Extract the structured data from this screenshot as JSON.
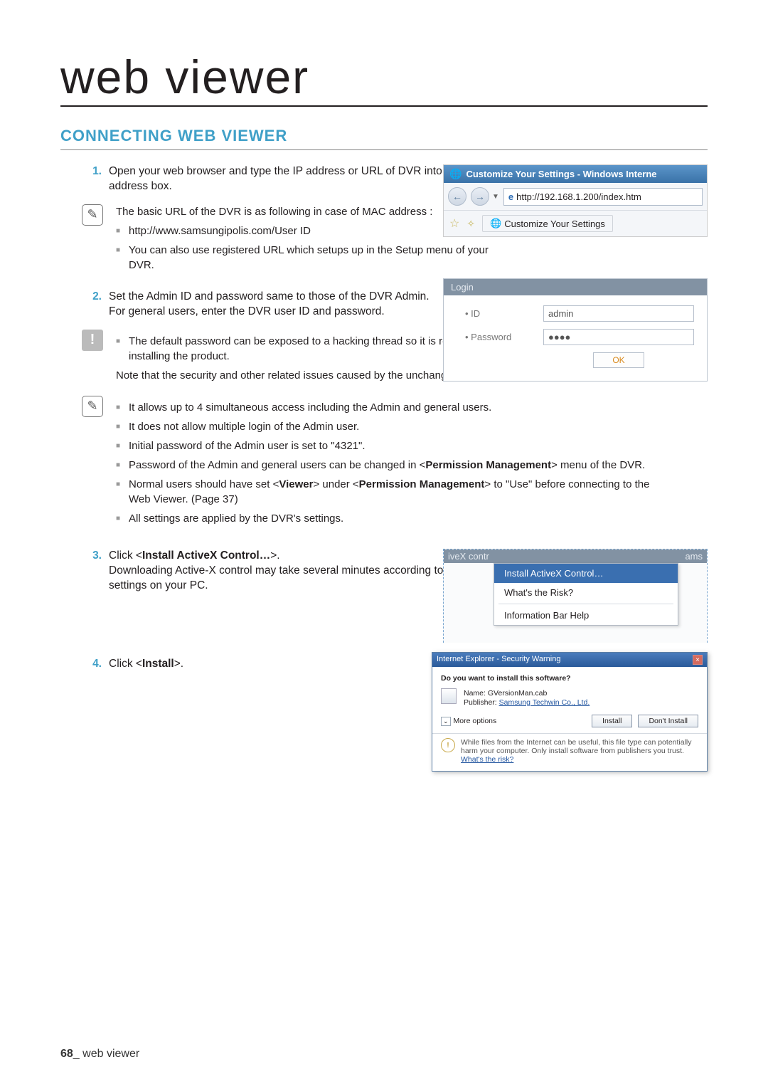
{
  "page_title": "web viewer",
  "section_title": "CONNECTING WEB VIEWER",
  "steps": {
    "s1": {
      "num": "1.",
      "text": "Open your web browser and type the IP address or URL of DVR into the URL address box."
    },
    "note1": {
      "text": "The basic URL of the DVR is as following in case of MAC address :",
      "b1": "http://www.samsungipolis.com/User ID",
      "b2": "You can also use registered URL which setups up in the Setup menu of your DVR."
    },
    "s2": {
      "num": "2.",
      "l1": "Set the Admin ID and password same to those of the DVR Admin.",
      "l2": "For general users, enter the DVR user ID and password."
    },
    "warn1": {
      "b1": "The default password can be exposed to a hacking thread so it is recommended to change the password after installing the product.",
      "b2": "Note that the security and other related issues caused by the unchanged password shall be responsible for the user."
    },
    "note2": {
      "b1": "It allows up to 4 simultaneous access including the Admin and general users.",
      "b2": "It does not allow multiple login of the Admin user.",
      "b3": "Initial password of the Admin user is set to \"4321\".",
      "b4_pre": "Password of the Admin and general users can be changed in <",
      "b4_bold": "Permission Management",
      "b4_post": "> menu of the DVR.",
      "b5_pre": "Normal users should have set <",
      "b5_bold1": "Viewer",
      "b5_mid": "> under <",
      "b5_bold2": "Permission Management",
      "b5_post": "> to \"Use\" before connecting to the Web Viewer. (Page 37)",
      "b6": "All settings are applied by the DVR's settings."
    },
    "s3": {
      "num": "3.",
      "pre": "Click <",
      "bold": "Install ActiveX Control…",
      "post": ">.",
      "l2": "Downloading Active-X control may take several minutes according to the security settings on your PC."
    },
    "s4": {
      "num": "4.",
      "pre": "Click <",
      "bold": "Install",
      "post": ">."
    }
  },
  "ie_window": {
    "title": "Customize Your Settings - Windows Interne",
    "url": "http://192.168.1.200/index.htm",
    "tab": "Customize Your Settings"
  },
  "login": {
    "title": "Login",
    "id_label": "ID",
    "id_value": "admin",
    "pw_label": "Password",
    "pw_value": "●●●●",
    "ok": "OK"
  },
  "ax": {
    "bar_left": "iveX contr",
    "bar_right": "ams",
    "item1": "Install ActiveX Control…",
    "item2": "What's the Risk?",
    "item3": "Information Bar Help"
  },
  "sec": {
    "title": "Internet Explorer - Security Warning",
    "q": "Do you want to install this software?",
    "name_label": "Name:",
    "name_value": "GVersionMan.cab",
    "pub_label": "Publisher:",
    "pub_value": "Samsung Techwin Co., Ltd.",
    "more": "More options",
    "install": "Install",
    "dont": "Don't Install",
    "warn": "While files from the Internet can be useful, this file type can potentially harm your computer. Only install software from publishers you trust. ",
    "warn_link": "What's the risk?"
  },
  "footer": {
    "page": "68",
    "label": "web viewer"
  }
}
